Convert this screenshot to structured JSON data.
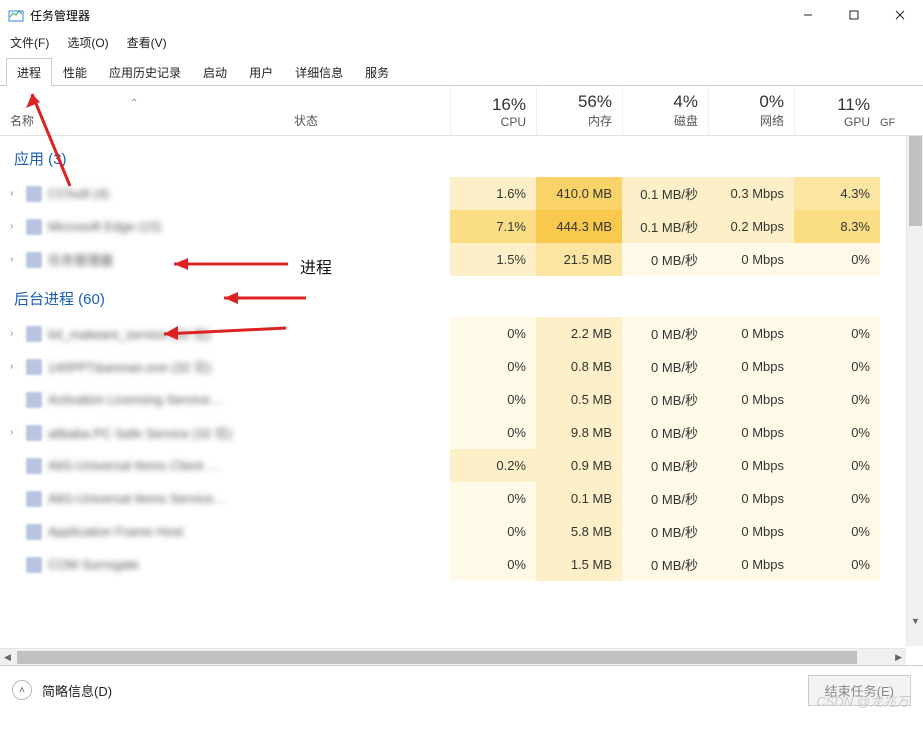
{
  "window": {
    "title": "任务管理器",
    "minimize": "—",
    "maximize": "☐",
    "close": "✕"
  },
  "menubar": {
    "file": "文件(F)",
    "options": "选项(O)",
    "view": "查看(V)"
  },
  "tabs": {
    "processes": "进程",
    "performance": "性能",
    "app_history": "应用历史记录",
    "startup": "启动",
    "users": "用户",
    "details": "详细信息",
    "services": "服务"
  },
  "columns": {
    "name": "名称",
    "status": "状态",
    "sort_indicator": "⌃",
    "cpu_pct": "16%",
    "cpu_label": "CPU",
    "mem_pct": "56%",
    "mem_label": "内存",
    "disk_pct": "4%",
    "disk_label": "磁盘",
    "net_pct": "0%",
    "net_label": "网络",
    "gpu_pct": "11%",
    "gpu_label": "GPU",
    "gpu_engine_trunc": "GF"
  },
  "groups": {
    "apps": "应用 (3)",
    "background": "后台进程 (60)"
  },
  "annotations": {
    "label": "进程"
  },
  "rows": {
    "app": [
      {
        "name": "CChuili (4)",
        "cpu": "1.6%",
        "mem": "410.0 MB",
        "disk": "0.1 MB/秒",
        "net": "0.3 Mbps",
        "gpu": "4.3%",
        "h": [
          "h1",
          "h4",
          "h1",
          "h1",
          "h2"
        ]
      },
      {
        "name": "Microsoft Edge (15)",
        "cpu": "7.1%",
        "mem": "444.3 MB",
        "disk": "0.1 MB/秒",
        "net": "0.2 Mbps",
        "gpu": "8.3%",
        "h": [
          "h3",
          "h5",
          "h1",
          "h1",
          "h3"
        ]
      },
      {
        "name": "任务管理器",
        "cpu": "1.5%",
        "mem": "21.5 MB",
        "disk": "0 MB/秒",
        "net": "0 Mbps",
        "gpu": "0%",
        "h": [
          "h1",
          "h2",
          "h0",
          "h0",
          "h0"
        ]
      }
    ],
    "bg": [
      {
        "name": "64_malware_service (32 位)",
        "cpu": "0%",
        "mem": "2.2 MB",
        "disk": "0 MB/秒",
        "net": "0 Mbps",
        "gpu": "0%",
        "h": [
          "h0",
          "h1",
          "h0",
          "h0",
          "h0"
        ],
        "chev": true
      },
      {
        "name": "140PPT&anman.exe (32 位)",
        "cpu": "0%",
        "mem": "0.8 MB",
        "disk": "0 MB/秒",
        "net": "0 Mbps",
        "gpu": "0%",
        "h": [
          "h0",
          "h1",
          "h0",
          "h0",
          "h0"
        ],
        "chev": true
      },
      {
        "name": "Activation Licensing Service…",
        "cpu": "0%",
        "mem": "0.5 MB",
        "disk": "0 MB/秒",
        "net": "0 Mbps",
        "gpu": "0%",
        "h": [
          "h0",
          "h1",
          "h0",
          "h0",
          "h0"
        ],
        "chev": false
      },
      {
        "name": "alibaba PC Safe Service (32 位)",
        "cpu": "0%",
        "mem": "9.8 MB",
        "disk": "0 MB/秒",
        "net": "0 Mbps",
        "gpu": "0%",
        "h": [
          "h0",
          "h1",
          "h0",
          "h0",
          "h0"
        ],
        "chev": true
      },
      {
        "name": "AliG-Universal Items Client …",
        "cpu": "0.2%",
        "mem": "0.9 MB",
        "disk": "0 MB/秒",
        "net": "0 Mbps",
        "gpu": "0%",
        "h": [
          "h1",
          "h1",
          "h0",
          "h0",
          "h0"
        ],
        "chev": false
      },
      {
        "name": "AliG-Universal Items Service…",
        "cpu": "0%",
        "mem": "0.1 MB",
        "disk": "0 MB/秒",
        "net": "0 Mbps",
        "gpu": "0%",
        "h": [
          "h0",
          "h1",
          "h0",
          "h0",
          "h0"
        ],
        "chev": false
      },
      {
        "name": "Application Frame Host",
        "cpu": "0%",
        "mem": "5.8 MB",
        "disk": "0 MB/秒",
        "net": "0 Mbps",
        "gpu": "0%",
        "h": [
          "h0",
          "h1",
          "h0",
          "h0",
          "h0"
        ],
        "chev": false
      },
      {
        "name": "COM Surrogate",
        "cpu": "0%",
        "mem": "1.5 MB",
        "disk": "0 MB/秒",
        "net": "0 Mbps",
        "gpu": "0%",
        "h": [
          "h0",
          "h1",
          "h0",
          "h0",
          "h0"
        ],
        "chev": false
      }
    ]
  },
  "footer": {
    "less_details": "简略信息(D)",
    "end_task": "结束任务(E)"
  },
  "watermark": "CSDN @龙兆万"
}
